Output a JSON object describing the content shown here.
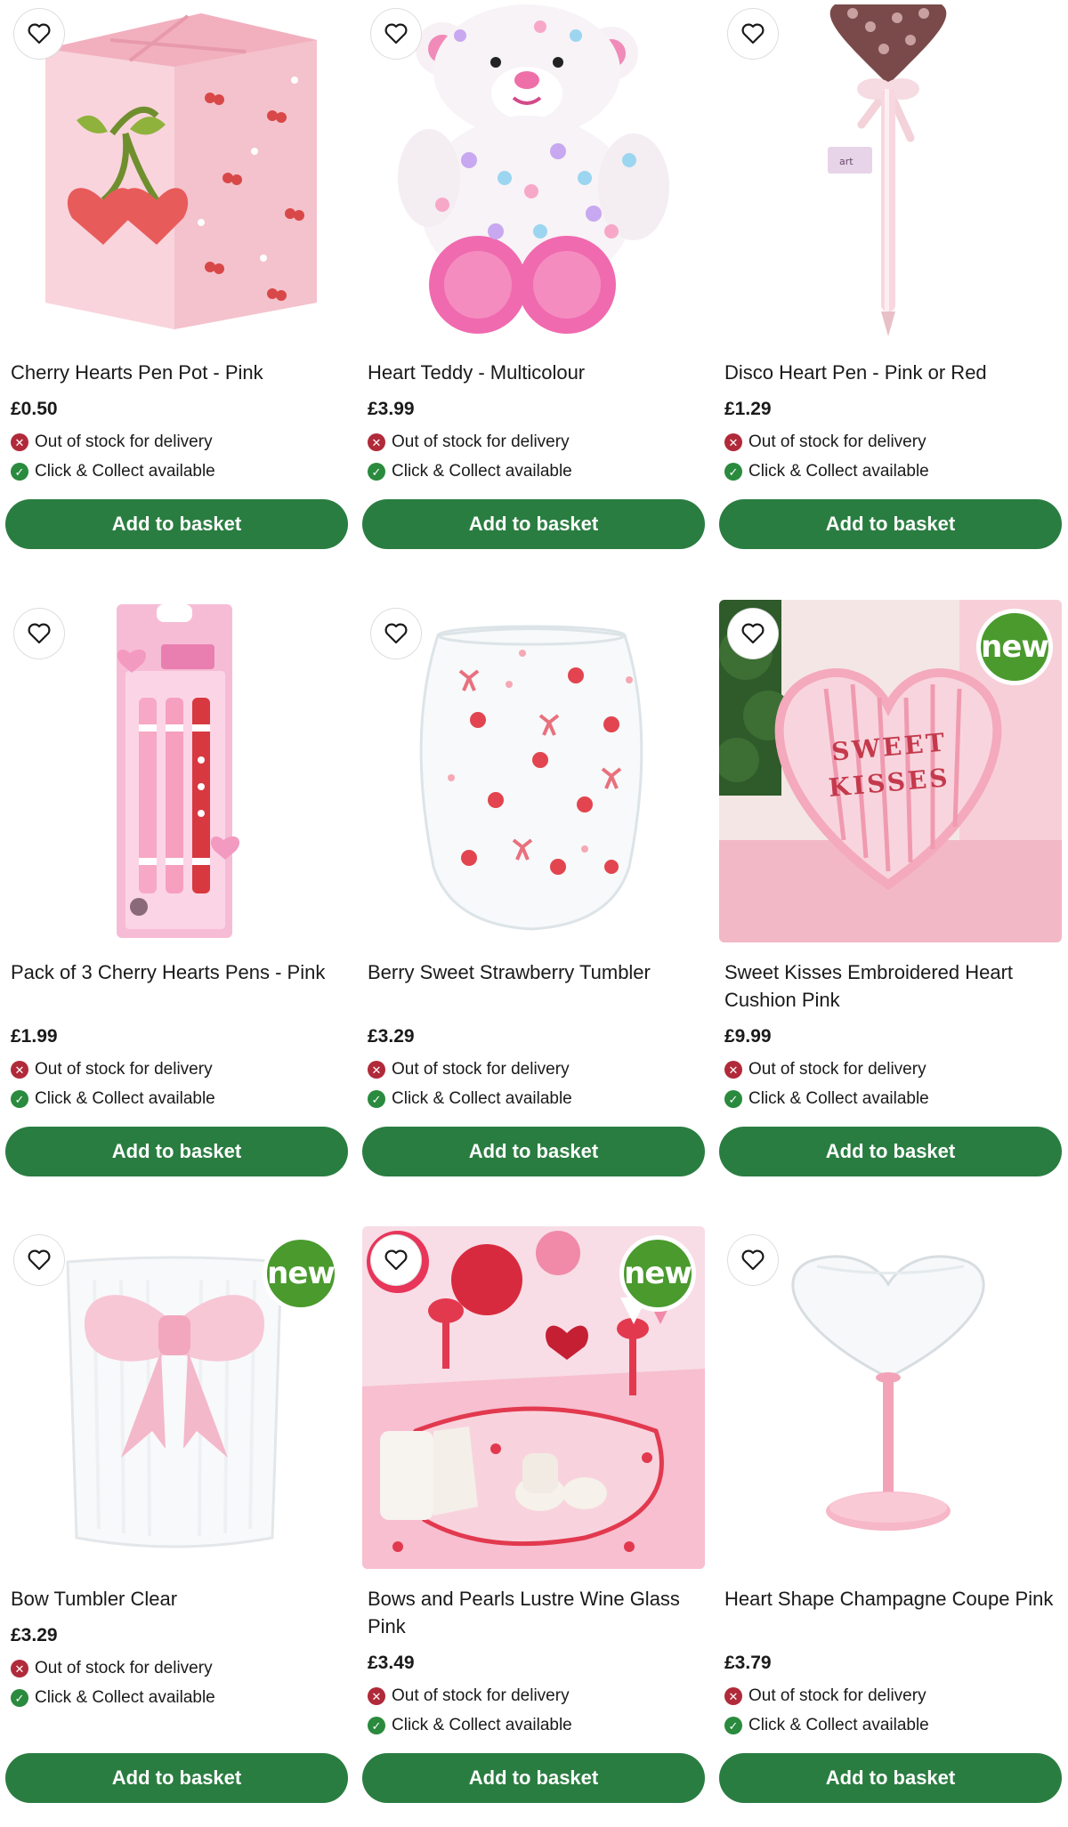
{
  "products": [
    {
      "title": "Cherry Hearts Pen Pot - Pink",
      "price": "£0.50",
      "delivery": "Out of stock for delivery",
      "collect": "Click & Collect available",
      "button": "Add to basket",
      "badge": ""
    },
    {
      "title": "Heart Teddy - Multicolour",
      "price": "£3.99",
      "delivery": "Out of stock for delivery",
      "collect": "Click & Collect available",
      "button": "Add to basket",
      "badge": ""
    },
    {
      "title": "Disco Heart Pen - Pink or Red",
      "price": "£1.29",
      "delivery": "Out of stock for delivery",
      "collect": "Click & Collect available",
      "button": "Add to basket",
      "badge": ""
    },
    {
      "title": "Pack of 3 Cherry Hearts Pens - Pink",
      "price": "£1.99",
      "delivery": "Out of stock for delivery",
      "collect": "Click & Collect available",
      "button": "Add to basket",
      "badge": ""
    },
    {
      "title": "Berry Sweet Strawberry Tumbler",
      "price": "£3.29",
      "delivery": "Out of stock for delivery",
      "collect": "Click & Collect available",
      "button": "Add to basket",
      "badge": ""
    },
    {
      "title": "Sweet Kisses Embroidered Heart Cushion Pink",
      "price": "£9.99",
      "delivery": "Out of stock for delivery",
      "collect": "Click & Collect available",
      "button": "Add to basket",
      "badge": "new"
    },
    {
      "title": "Bow Tumbler Clear",
      "price": "£3.29",
      "delivery": "Out of stock for delivery",
      "collect": "Click & Collect available",
      "button": "Add to basket",
      "badge": "new"
    },
    {
      "title": "Bows and Pearls Lustre Wine Glass Pink",
      "price": "£3.49",
      "delivery": "Out of stock for delivery",
      "collect": "Click & Collect available",
      "button": "Add to basket",
      "badge": "new"
    },
    {
      "title": "Heart Shape Champagne Coupe Pink",
      "price": "£3.79",
      "delivery": "Out of stock for delivery",
      "collect": "Click & Collect available",
      "button": "Add to basket",
      "badge": ""
    }
  ],
  "cushion_text": "SWEET KISSES",
  "icons": {
    "favourite": "heart-outline-icon",
    "out_of_stock": "cross-circle-icon",
    "available": "check-circle-icon"
  },
  "colors": {
    "button": "#2a7d41",
    "new_badge": "#4a9a2e",
    "out_of_stock": "#b02a3a",
    "available": "#2a8a3e"
  }
}
